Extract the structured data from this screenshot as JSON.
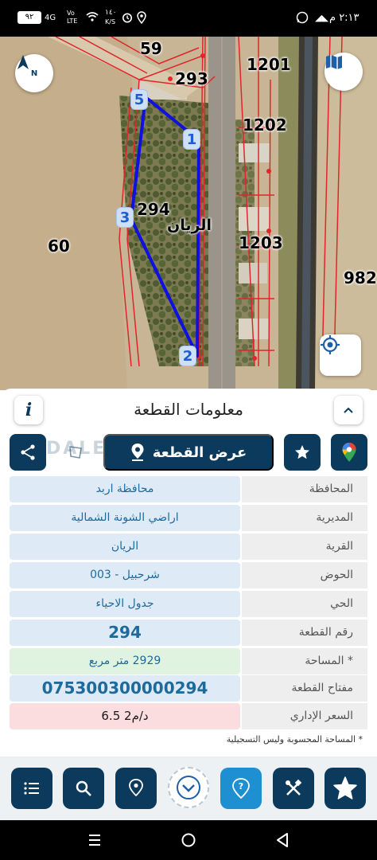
{
  "status_bar": {
    "battery": "٩٢",
    "network": "4G",
    "volte": "Vo LTE",
    "speed_value": "١٤٠",
    "speed_unit": "K/S",
    "time": "٢:١٣ م"
  },
  "map": {
    "parcel_labels": {
      "p59": "59",
      "p293": "293",
      "p1201": "1201",
      "p1202": "1202",
      "p294": "294",
      "p1203": "1203",
      "p60": "60",
      "p982": "982"
    },
    "village_name": "الريان",
    "compass_letter": "N",
    "vertices": [
      "1",
      "2",
      "3",
      "5"
    ]
  },
  "panel": {
    "title": "معلومات القطعة",
    "info_label": "i",
    "show_parcel_label": "عرض القطعة",
    "watermark": "DALEEL AQAR",
    "rows": [
      {
        "label": "المحافظة",
        "value": "محافظة اربد"
      },
      {
        "label": "المديرية",
        "value": "اراضي الشونة الشمالية"
      },
      {
        "label": "القرية",
        "value": "الريان"
      },
      {
        "label": "الحوض",
        "value": "شرحبيل - 003"
      },
      {
        "label": "الحي",
        "value": "جدول الاحياء"
      },
      {
        "label": "رقم القطعة",
        "value": "294"
      },
      {
        "label": "المساحة *",
        "value": "2929   متر مربع"
      },
      {
        "label": "مفتاح القطعة",
        "value": "075300300000294"
      },
      {
        "label": "السعر الإداري",
        "value": "6.5 د/م2"
      }
    ],
    "note": "* المساحة المحسوبة وليس التسجيلية"
  },
  "colors": {
    "primary_dark": "#0c3a5c",
    "value_bg": "#deeaf5",
    "area_bg": "#dff3e0",
    "price_bg": "#fbdde0",
    "polygon": "#1010e0",
    "parcel_lines": "#e0262a"
  },
  "icons": {
    "bottom_bar": [
      "list-icon",
      "search-icon",
      "location-pin-icon",
      "chevron-down-icon",
      "help-icon",
      "tools-icon",
      "star-icon"
    ]
  }
}
